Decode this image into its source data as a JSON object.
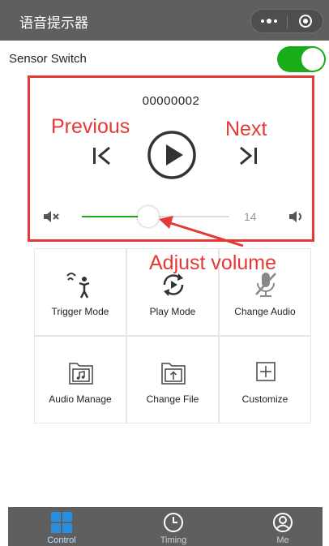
{
  "header": {
    "title": "语音提示器"
  },
  "sensor": {
    "label": "Sensor Switch",
    "enabled": true
  },
  "player": {
    "track": "00000002",
    "volume": {
      "value": "14",
      "fraction": 0.45
    }
  },
  "annotations": {
    "previous": "Previous",
    "next": "Next",
    "adjust": "Adjust volume"
  },
  "grid": {
    "items": [
      {
        "label": "Trigger Mode",
        "icon": "trigger-mode-icon"
      },
      {
        "label": "Play Mode",
        "icon": "play-mode-icon"
      },
      {
        "label": "Change Audio",
        "icon": "mic-off-icon"
      },
      {
        "label": "Audio Manage",
        "icon": "music-folder-icon"
      },
      {
        "label": "Change File",
        "icon": "upload-folder-icon"
      },
      {
        "label": "Customize",
        "icon": "plus-box-icon"
      }
    ]
  },
  "tabs": [
    {
      "label": "Control",
      "icon": "grid-icon",
      "active": true
    },
    {
      "label": "Timing",
      "icon": "clock-icon",
      "active": false
    },
    {
      "label": "Me",
      "icon": "user-icon",
      "active": false
    }
  ],
  "colors": {
    "accent_green": "#1aad19",
    "annotation_red": "#e53935",
    "bar_gray": "#5f5f5f",
    "active_tab_blue": "#2b8fe0"
  }
}
